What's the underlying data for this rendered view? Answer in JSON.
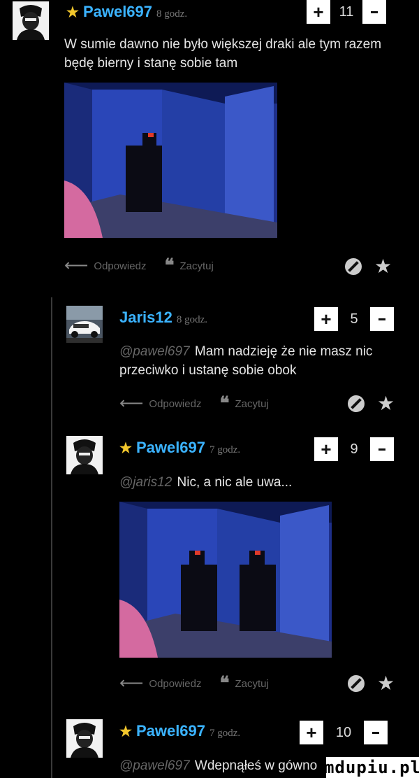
{
  "comments": [
    {
      "author": "Pawel697",
      "time": "8 godz.",
      "votes": "11",
      "text": "W sumie dawno nie było większej draki ale tym razem będę bierny i stanę sobie tam",
      "mention": "",
      "reply_label": "Odpowiedz",
      "quote_label": "Zacytuj"
    },
    {
      "author": "Jaris12",
      "time": "8 godz.",
      "votes": "5",
      "mention": "@pawel697",
      "text": "Mam nadzieję że nie masz nic przeciwko i ustanę sobie obok",
      "reply_label": "Odpowiedz",
      "quote_label": "Zacytuj"
    },
    {
      "author": "Pawel697",
      "time": "7 godz.",
      "votes": "9",
      "mention": "@jaris12",
      "text": "Nic, a nic ale uwa...",
      "reply_label": "Odpowiedz",
      "quote_label": "Zacytuj"
    },
    {
      "author": "Pawel697",
      "time": "7 godz.",
      "votes": "10",
      "mention": "@pawel697",
      "text": "Wdepnąłeś w gówno"
    }
  ],
  "watermark": "mdupiu.pl",
  "icons": {
    "star": "star-icon",
    "reply": "reply-arrow-icon",
    "quote": "quote-icon",
    "block": "block-icon",
    "plus": "plus-icon",
    "minus": "minus-icon"
  },
  "colors": {
    "author": "#3bb3ff",
    "star": "#f3c72c",
    "background": "#000000"
  }
}
